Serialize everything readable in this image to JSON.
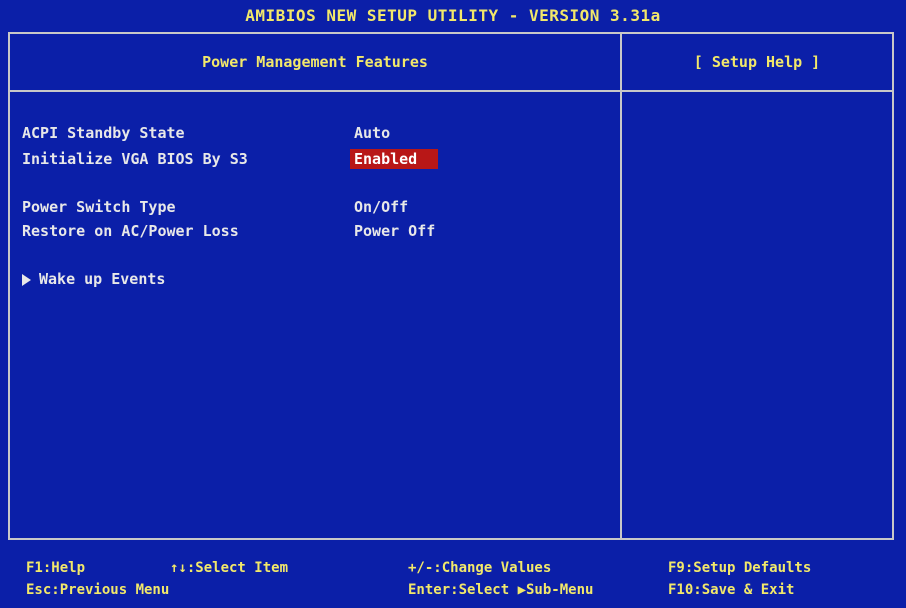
{
  "window": {
    "title": "AMIBIOS NEW SETUP UTILITY - VERSION 3.31a"
  },
  "left_panel": {
    "header": "Power Management Features"
  },
  "right_panel": {
    "header": "[ Setup Help ]"
  },
  "settings": [
    {
      "label": "ACPI Standby State",
      "value": "Auto",
      "selected": false
    },
    {
      "label": "Initialize VGA BIOS By S3",
      "value": "Enabled",
      "selected": true
    },
    {
      "label": "Power Switch Type",
      "value": "On/Off",
      "selected": false
    },
    {
      "label": "Restore on AC/Power Loss",
      "value": "Power Off",
      "selected": false
    }
  ],
  "submenu": {
    "label": "Wake up Events",
    "icon": "right-triangle-icon"
  },
  "footer": {
    "f1": "F1:Help",
    "select_item": "↑↓:Select Item",
    "change_values": "+/-:Change Values",
    "f9": "F9:Setup Defaults",
    "esc": "Esc:Previous Menu",
    "enter": "Enter:Select ▶Sub-Menu",
    "f10": "F10:Save & Exit"
  },
  "colors": {
    "background": "#0b1fa8",
    "highlight": "#b81717",
    "title_text": "#f2e86a",
    "body_text": "#e8e8e8",
    "border": "#c8c8c8"
  }
}
